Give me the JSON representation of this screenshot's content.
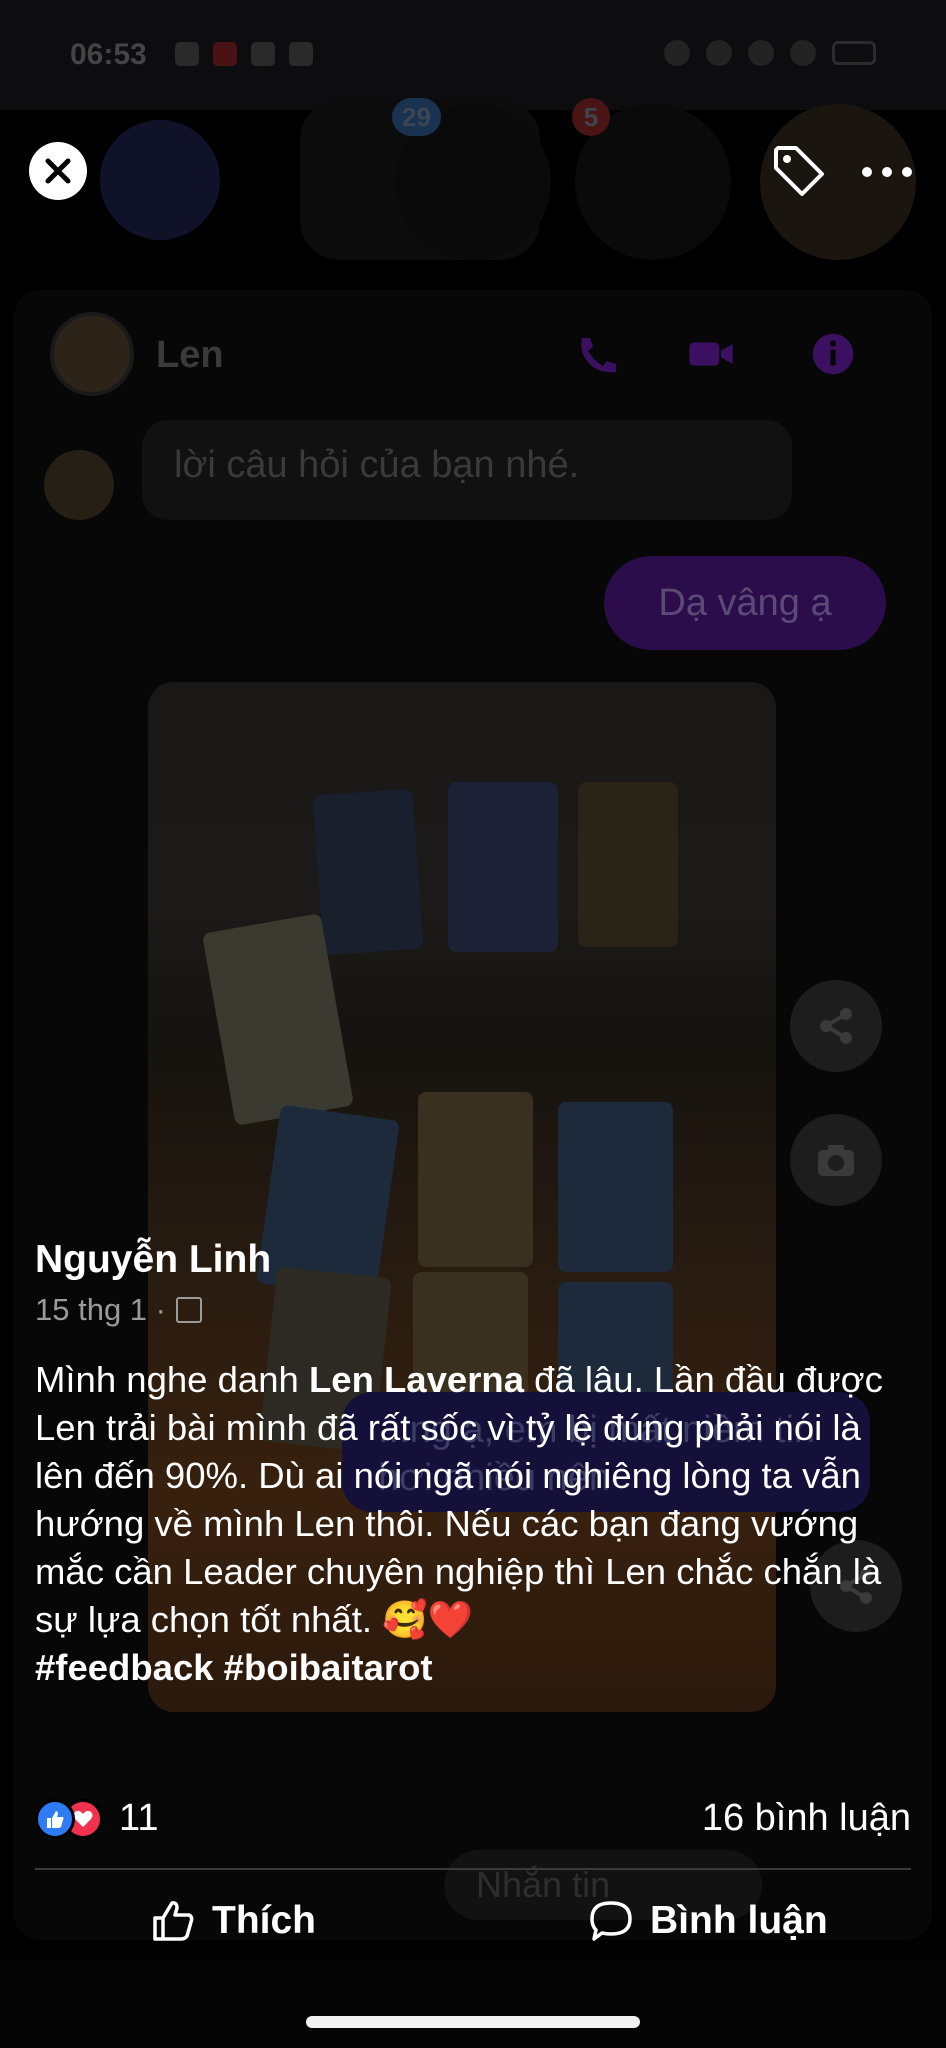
{
  "status_bar": {
    "time": "06:53"
  },
  "bubbles": {
    "badge_1": "29",
    "badge_2": "5"
  },
  "chat": {
    "contact_name": "Len",
    "incoming_message": "lời câu hỏi của bạn nhé.",
    "outgoing_message": "Dạ vâng ạ",
    "outgoing_message_2": "...ng ạ, em bị mất niềm tin hơi nhiều nên",
    "composer_placeholder": "Nhắn tin"
  },
  "post": {
    "author": "Nguyễn Linh",
    "date": "15 thg 1 ·",
    "body_part1": "Mình nghe danh ",
    "body_bold": "Len Laverna",
    "body_part2": " đã lâu. Lần đầu được Len trải bài mình đã rất sốc vì tỷ lệ đúng phải nói là lên đến 90%. Dù ai nói ngã nói nghiêng lòng ta vẫn hướng về mình Len thôi. Nếu các bạn đang vướng mắc cần Leader chuyên nghiệp thì Len chắc chắn là sự lựa chọn tốt nhất.  🥰❤️",
    "hashtags": "#feedback #boibaitarot",
    "reaction_count": "11",
    "comment_count": "16 bình luận",
    "like_label": "Thích",
    "comment_label": "Bình luận"
  },
  "colors": {
    "like_blue": "#2d7cf6",
    "love_red": "#f2314f",
    "messenger_purple": "#7b2ff7"
  },
  "icons": {
    "close": "close-icon",
    "tag": "tag-icon",
    "more": "more-icon",
    "like": "thumbs-up-icon",
    "comment": "comment-icon"
  }
}
